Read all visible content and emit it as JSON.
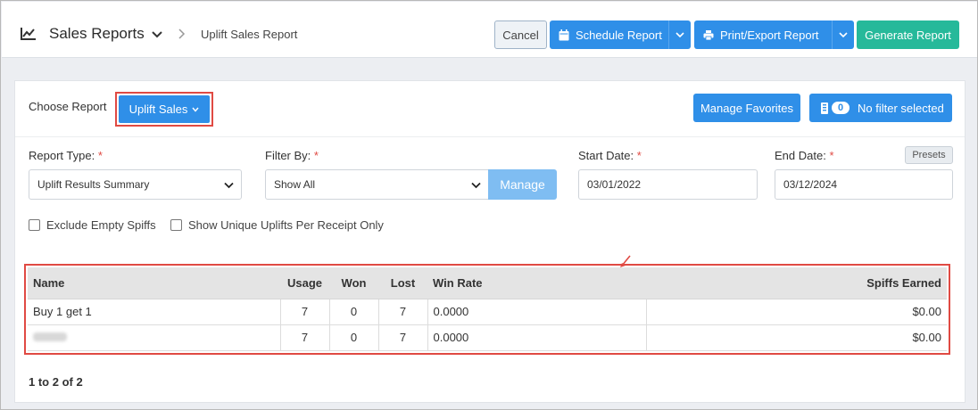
{
  "header": {
    "app_title": "Sales Reports",
    "breadcrumb": "Uplift Sales Report",
    "buttons": {
      "cancel": "Cancel",
      "schedule": "Schedule Report",
      "print_export": "Print/Export Report",
      "generate": "Generate Report"
    }
  },
  "controls": {
    "choose_label": "Choose Report",
    "report_button": "Uplift Sales",
    "manage_favorites": "Manage Favorites",
    "filter_count": "0",
    "filter_label": "No filter selected"
  },
  "form": {
    "report_type_label": "Report Type:",
    "report_type_value": "Uplift Results Summary",
    "filter_by_label": "Filter By:",
    "filter_by_value": "Show All",
    "manage_button": "Manage",
    "start_date_label": "Start Date:",
    "start_date_value": "03/01/2022",
    "end_date_label": "End Date:",
    "end_date_value": "03/12/2024",
    "presets_button": "Presets",
    "required_mark": "*",
    "exclude_empty_label": "Exclude Empty Spiffs",
    "show_unique_label": "Show Unique Uplifts Per Receipt Only"
  },
  "table": {
    "columns": [
      "Name",
      "Usage",
      "Won",
      "Lost",
      "Win Rate",
      "Spiffs Earned"
    ],
    "rows": [
      {
        "name": "Buy 1 get 1",
        "usage": "7",
        "won": "0",
        "lost": "7",
        "win_rate": "0.0000",
        "spiffs": "$0.00"
      },
      {
        "name": "",
        "usage": "7",
        "won": "0",
        "lost": "7",
        "win_rate": "0.0000",
        "spiffs": "$0.00"
      }
    ]
  },
  "pagination": "1 to 2 of 2",
  "colors": {
    "primary": "#2f8fe8",
    "success": "#26b99a",
    "highlight_border": "#e04a43"
  }
}
